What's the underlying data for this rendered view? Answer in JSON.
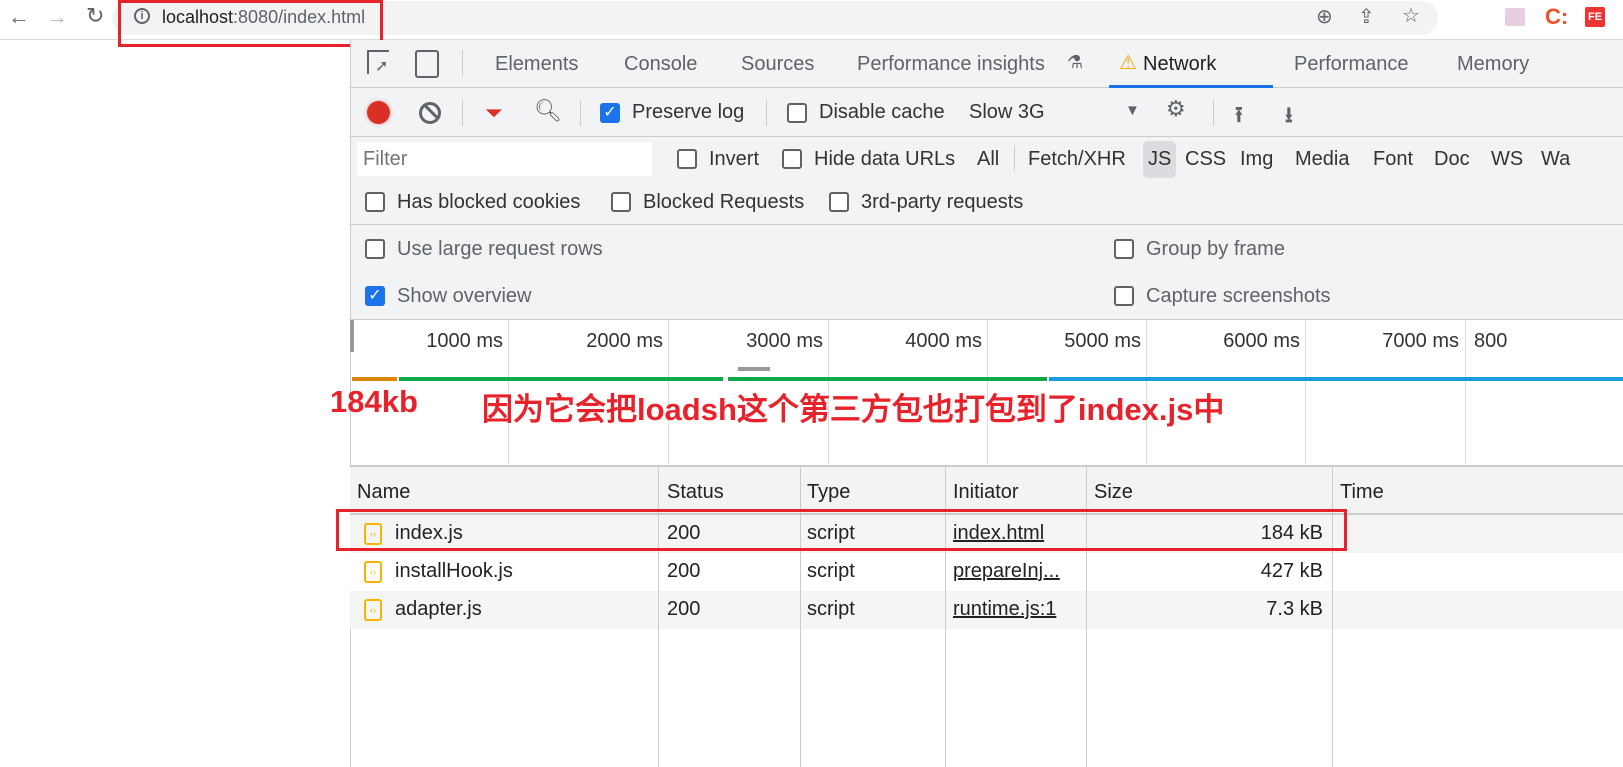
{
  "browser": {
    "url_host": "localhost",
    "url_rest": ":8080/index.html"
  },
  "tabs": [
    "Elements",
    "Console",
    "Sources",
    "Performance insights",
    "Network",
    "Performance",
    "Memory"
  ],
  "active_tab": "Network",
  "toolbar": {
    "preserve_log": "Preserve log",
    "preserve_log_checked": true,
    "disable_cache": "Disable cache",
    "throttle": "Slow 3G"
  },
  "filter": {
    "placeholder": "Filter",
    "invert": "Invert",
    "hide_data_urls": "Hide data URLs",
    "types": [
      "All",
      "Fetch/XHR",
      "JS",
      "CSS",
      "Img",
      "Media",
      "Font",
      "Doc",
      "WS",
      "Wa"
    ],
    "active_type": "JS"
  },
  "filter2": {
    "blocked_cookies": "Has blocked cookies",
    "blocked_requests": "Blocked Requests",
    "third_party": "3rd-party requests"
  },
  "settings": {
    "large_rows": "Use large request rows",
    "group_by_frame": "Group by frame",
    "show_overview": "Show overview",
    "show_overview_checked": true,
    "capture": "Capture screenshots"
  },
  "timeline": {
    "ticks": [
      "1000 ms",
      "2000 ms",
      "3000 ms",
      "4000 ms",
      "5000 ms",
      "6000 ms",
      "7000 ms",
      "800"
    ]
  },
  "annotation": {
    "size": "184kb",
    "note": "因为它会把loadsh这个第三方包也打包到了index.js中"
  },
  "table": {
    "headers": [
      "Name",
      "Status",
      "Type",
      "Initiator",
      "Size",
      "Time"
    ],
    "rows": [
      {
        "name": "index.js",
        "status": "200",
        "type": "script",
        "initiator": "index.html",
        "size": "184 kB"
      },
      {
        "name": "installHook.js",
        "status": "200",
        "type": "script",
        "initiator": "prepareInj...",
        "size": "427 kB"
      },
      {
        "name": "adapter.js",
        "status": "200",
        "type": "script",
        "initiator": "runtime.js:1",
        "size": "7.3 kB"
      }
    ]
  },
  "colors": {
    "accent": "#1a73e8",
    "annotation": "#e8222a",
    "record": "#d93025"
  }
}
